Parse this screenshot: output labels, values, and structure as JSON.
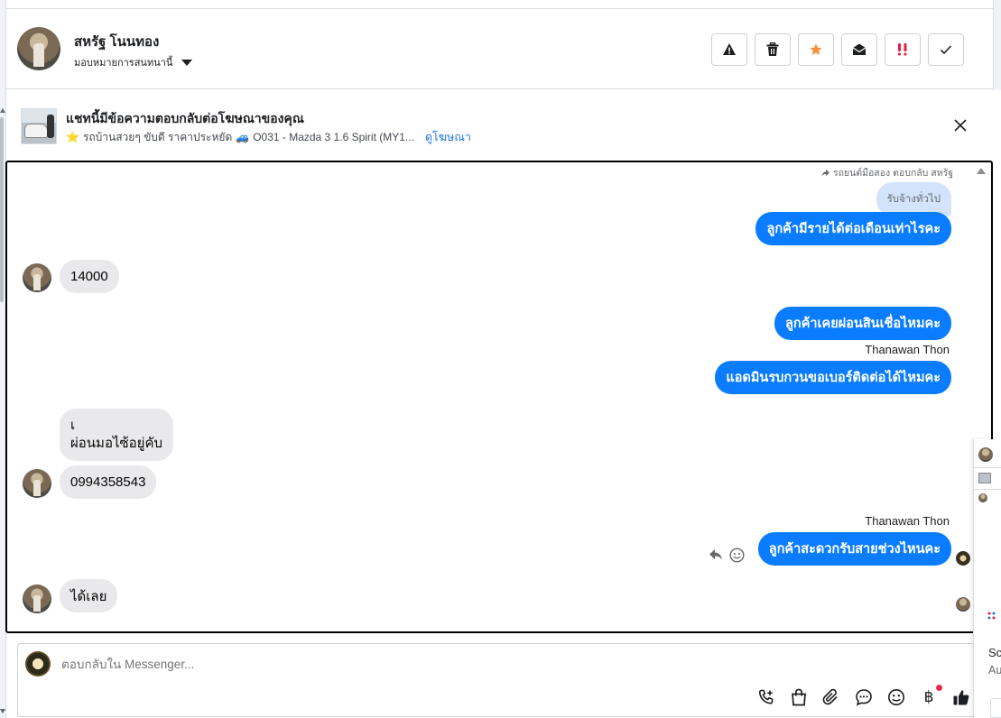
{
  "header": {
    "name": "สหรัฐ โนนทอง",
    "assign_label": "มอบหมายการสนทนานี้",
    "toolbar": [
      {
        "name": "warning-icon",
        "label": "Report"
      },
      {
        "name": "trash-icon",
        "label": "Delete"
      },
      {
        "name": "star-icon",
        "label": "Star"
      },
      {
        "name": "mail-open-icon",
        "label": "Mark unread"
      },
      {
        "name": "priority-icon",
        "label": "Priority"
      },
      {
        "name": "check-icon",
        "label": "Done"
      }
    ]
  },
  "ad": {
    "title": "แชทนี้มีข้อความตอบกลับต่อโฆษณาของคุณ",
    "star_emoji": "⭐",
    "detail": "รถบ้านสวยๆ ขับดี ราคาประหยัด",
    "car_emoji": "🚙",
    "model": "O031 - Mazda 3 1.6 Spirit (MY1...",
    "link": "ดูโฆษณา"
  },
  "chat": {
    "replied_note": "รถยนต์มือสอง ตอบกลับ สหรัฐ",
    "quoted_text": "รับจ้างทั่วไป",
    "messages": [
      {
        "dir": "out",
        "text": "ลูกค้ามีรายได้ต่อเดือนเท่าไรคะ"
      },
      {
        "dir": "in",
        "text": "14000"
      },
      {
        "dir": "out",
        "text": "ลูกค้าเคยผ่อนสินเชื่อไหมคะ"
      },
      {
        "dir": "label",
        "text": "Thanawan Thon"
      },
      {
        "dir": "out",
        "text": "แอดมินรบกวนขอเบอร์ติดต่อได้ไหมคะ"
      },
      {
        "dir": "in",
        "text_line1": "เ",
        "text_line2": "ผ่อนมอไซ้อยู่คับ"
      },
      {
        "dir": "in",
        "text": "0994358543"
      },
      {
        "dir": "label",
        "text": "Thanawan Thon"
      },
      {
        "dir": "out",
        "text": "ลูกค้าสะดวกรับสายช่วงไหนคะ"
      },
      {
        "dir": "in",
        "text": "ได้เลย"
      }
    ]
  },
  "composer": {
    "placeholder": "ตอบกลับใน Messenger...",
    "icons": [
      "phone-plus-icon",
      "shopping-bag-icon",
      "paperclip-icon",
      "saved-reply-icon",
      "emoji-icon",
      "baht-icon",
      "thumbs-up-icon"
    ],
    "currency_symbol": "฿"
  },
  "side_panel": {
    "line1": "Sc",
    "line2": "Au"
  },
  "colors": {
    "outgoing_bubble": "#0a7cff",
    "incoming_bubble": "#e9e9eb",
    "quoted_bubble": "#d3e3fb",
    "link": "#1b74e4",
    "star": "#f7923b",
    "priority": "#e41e3f"
  }
}
